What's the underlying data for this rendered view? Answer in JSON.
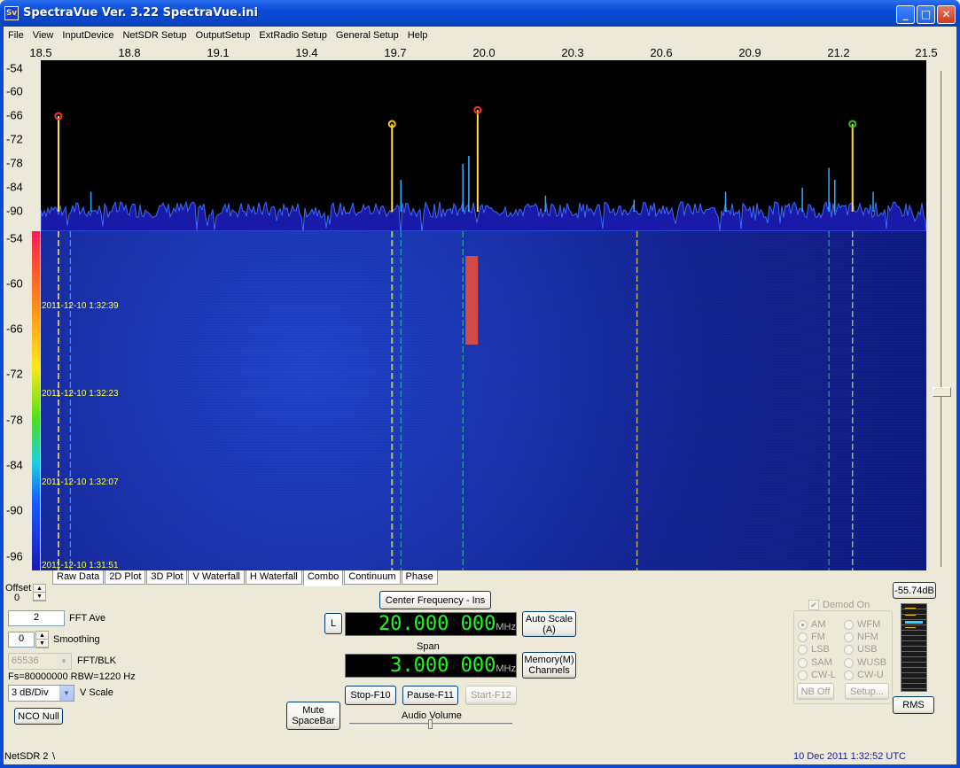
{
  "window": {
    "title": "SpectraVue Ver. 3.22 SpectraVue.ini",
    "icon_text": "Sv"
  },
  "menu": [
    "File",
    "View",
    "InputDevice",
    "NetSDR Setup",
    "OutputSetup",
    "ExtRadio Setup",
    "General Setup",
    "Help"
  ],
  "freq_axis": [
    "18.5",
    "18.8",
    "19.1",
    "19.4",
    "19.7",
    "20.0",
    "20.3",
    "20.6",
    "20.9",
    "21.2",
    "21.5"
  ],
  "spectrum_db_labels": [
    "-54",
    "-60",
    "-66",
    "-72",
    "-78",
    "-84",
    "-90"
  ],
  "waterfall_db_labels": [
    "-54",
    "-60",
    "-66",
    "-72",
    "-78",
    "-84",
    "-90",
    "-96"
  ],
  "timestamps": [
    "2011-12-10 1:32:39",
    "2011-12-10 1:32:23",
    "2011-12-10 1:32:07",
    "2011-12-10 1:31:51"
  ],
  "tabs": [
    "Raw Data",
    "2D Plot",
    "3D Plot",
    "V Waterfall",
    "H Waterfall",
    "Combo",
    "Continuum",
    "Phase"
  ],
  "active_tab": "Combo",
  "controls": {
    "offset_label": "Offset",
    "offset_value": "0",
    "fft_ave_value": "2",
    "fft_ave_label": "FFT Ave",
    "smoothing_value": "0",
    "smoothing_label": "Smoothing",
    "fft_blk_value": "65536",
    "fft_blk_label": "FFT/BLK",
    "fs_rbw": "Fs=80000000 RBW=1220 Hz",
    "vscale_value": "3 dB/Div",
    "vscale_label": "V Scale",
    "nco_null": "NCO Null"
  },
  "center": {
    "button": "Center Frequency - Ins",
    "l_button": "L",
    "freq_value": "20.000 000",
    "freq_unit": "MHz",
    "auto_scale": "Auto Scale",
    "auto_scale_key": "(A)",
    "span_label": "Span",
    "span_value": "3.000 000",
    "span_unit": "MHz",
    "memory": "Memory(M)",
    "memory_sub": "Channels",
    "stop": "Stop-F10",
    "pause": "Pause-F11",
    "start": "Start-F12",
    "mute": "Mute",
    "mute_sub": "SpaceBar",
    "audio_volume": "Audio Volume"
  },
  "demod": {
    "demod_on": "Demod On",
    "modes_left": [
      "AM",
      "FM",
      "LSB",
      "SAM",
      "CW-L"
    ],
    "modes_right": [
      "WFM",
      "NFM",
      "USB",
      "WUSB",
      "CW-U"
    ],
    "selected": "AM",
    "nb_off": "NB Off",
    "setup": "Setup...",
    "level": "-55.74dB",
    "rms": "RMS"
  },
  "status": {
    "device": "NetSDR 2",
    "device_extra": "\\",
    "datetime": "10 Dec 2011  1:32:52 UTC"
  },
  "colors": {
    "lcd_green": "#1aff1a",
    "timestamp_yellow": "#ffff40",
    "status_blue": "#1a1a9c"
  },
  "chart_data": {
    "type": "line",
    "xlabel": "",
    "ylabel": "",
    "xlim": [
      18.5,
      21.5
    ],
    "ylim": [
      -93,
      -54
    ],
    "x_ticks": [
      18.5,
      18.8,
      19.1,
      19.4,
      19.7,
      20.0,
      20.3,
      20.6,
      20.9,
      21.2,
      21.5
    ],
    "y_ticks": [
      -54,
      -60,
      -66,
      -72,
      -78,
      -84,
      -90
    ],
    "noise_floor_db": -90,
    "peaks": [
      {
        "freq": 18.56,
        "db": -66,
        "marker_color": "#ff3030"
      },
      {
        "freq": 19.69,
        "db": -68,
        "marker_color": "#ffc020"
      },
      {
        "freq": 19.98,
        "db": -64.5,
        "marker_color": "#ff3030"
      },
      {
        "freq": 21.25,
        "db": -68,
        "marker_color": "#30c030"
      }
    ],
    "minor_peaks": [
      {
        "freq": 18.67,
        "db": -85
      },
      {
        "freq": 19.72,
        "db": -82
      },
      {
        "freq": 19.93,
        "db": -78
      },
      {
        "freq": 19.95,
        "db": -76
      },
      {
        "freq": 20.21,
        "db": -86
      },
      {
        "freq": 20.51,
        "db": -87
      },
      {
        "freq": 20.82,
        "db": -85
      },
      {
        "freq": 21.08,
        "db": -84
      },
      {
        "freq": 21.17,
        "db": -79
      },
      {
        "freq": 21.19,
        "db": -82
      },
      {
        "freq": 21.32,
        "db": -85
      }
    ]
  }
}
